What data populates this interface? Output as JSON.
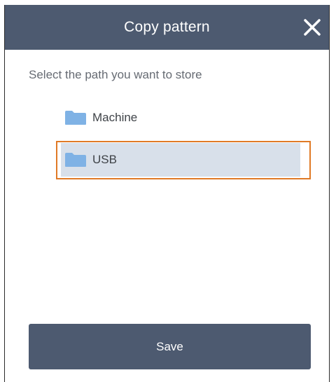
{
  "dialog": {
    "title": "Copy pattern",
    "close_icon": "close-icon",
    "prompt": "Select the path you want to store",
    "paths": [
      {
        "label": "Machine",
        "icon": "folder-icon",
        "selected": false
      },
      {
        "label": "USB",
        "icon": "folder-icon",
        "selected": true
      }
    ],
    "save_label": "Save"
  },
  "colors": {
    "header_bg": "#4d5a70",
    "selected_bg": "#d8e0ea",
    "highlight_border": "#e07a26",
    "folder": "#7fb2e5",
    "button_bg": "#4d5a70"
  }
}
